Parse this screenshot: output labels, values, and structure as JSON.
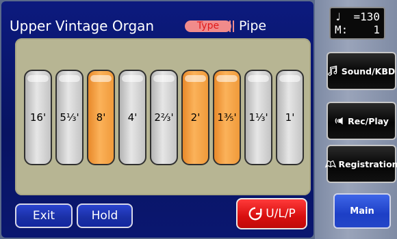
{
  "display": {
    "title": "Upper Vintage Organ",
    "type_label": "Type",
    "type_value": "Pipe"
  },
  "drawbars": [
    {
      "label": "16'",
      "active": false
    },
    {
      "label": "5⅓'",
      "active": false
    },
    {
      "label": "8'",
      "active": true
    },
    {
      "label": "4'",
      "active": false
    },
    {
      "label": "2⅔'",
      "active": false
    },
    {
      "label": "2'",
      "active": true
    },
    {
      "label": "1⅗'",
      "active": true
    },
    {
      "label": "1⅓'",
      "active": false
    },
    {
      "label": "1'",
      "active": false
    }
  ],
  "buttons": {
    "exit": "Exit",
    "hold": "Hold",
    "ulp": "U/L/P"
  },
  "tempo": {
    "note_symbol": "♩",
    "tempo_value": "=130",
    "measure_label": "M:",
    "measure_value": "1"
  },
  "side": {
    "sound_kbd": "Sound/KBD",
    "rec_play": "Rec/Play",
    "registration": "Registration",
    "main": "Main"
  },
  "colors": {
    "active_bar": "#f5a040",
    "inactive_bar": "#d0d0d0",
    "screen_bg": "#0a1670",
    "ulp_button": "#e01818"
  }
}
